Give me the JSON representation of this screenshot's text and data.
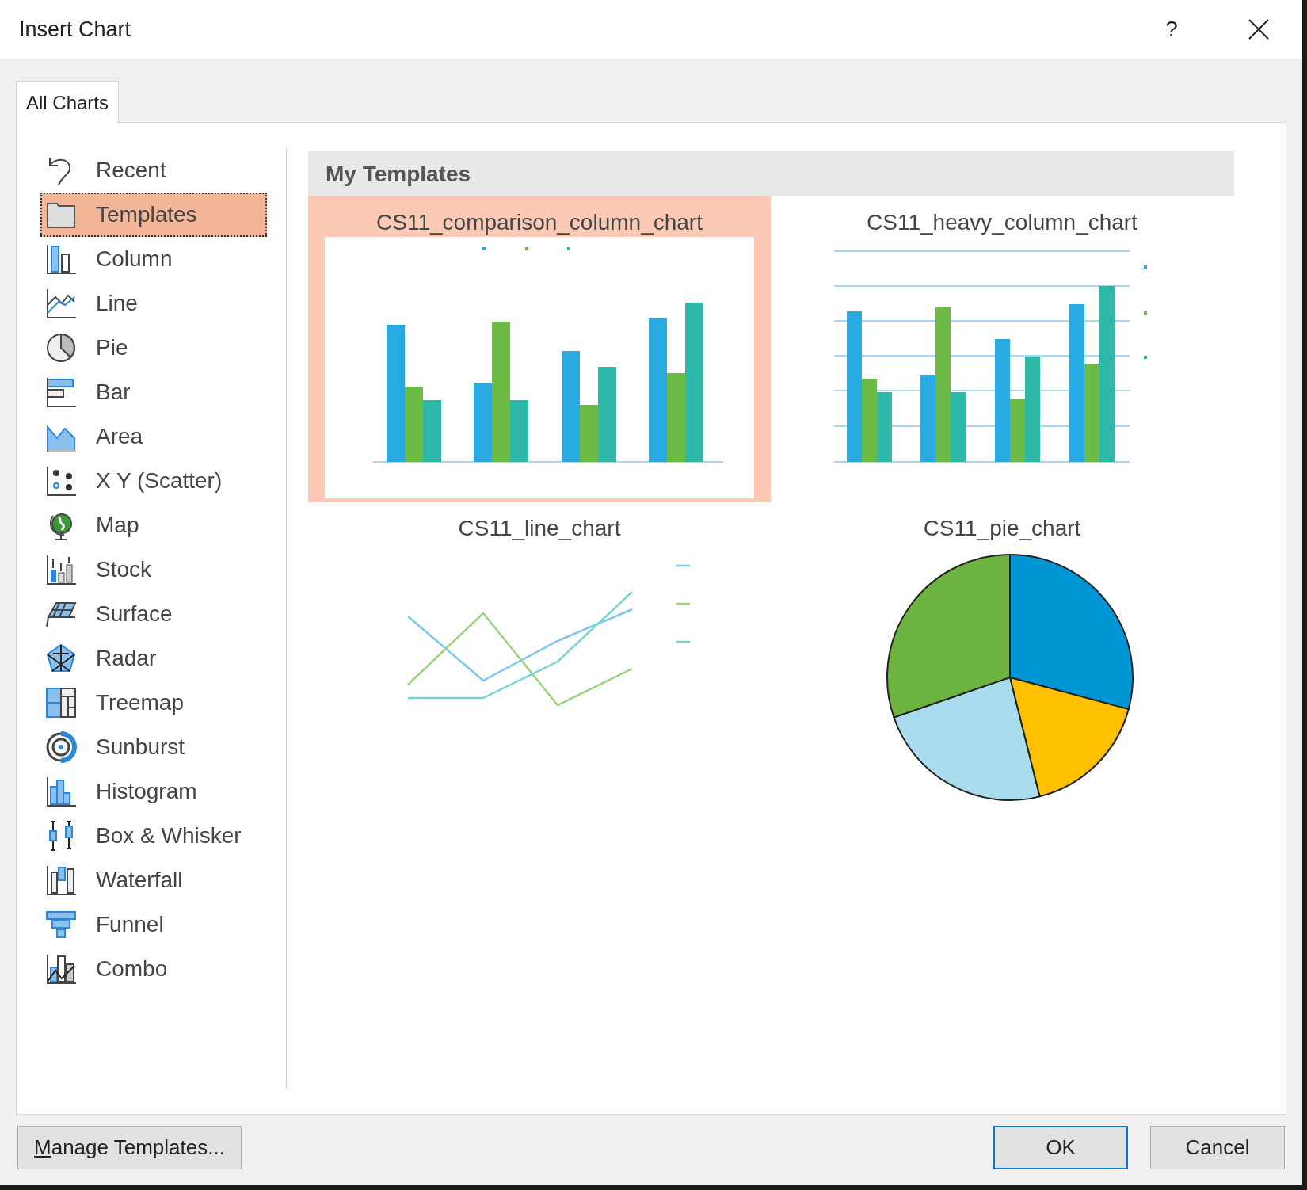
{
  "window": {
    "title": "Insert Chart",
    "help": "?"
  },
  "tabs": [
    {
      "label": "All Charts",
      "selected": true
    }
  ],
  "categories": [
    {
      "label": "Recent",
      "selected": false
    },
    {
      "label": "Templates",
      "selected": true
    },
    {
      "label": "Column",
      "selected": false
    },
    {
      "label": "Line",
      "selected": false
    },
    {
      "label": "Pie",
      "selected": false
    },
    {
      "label": "Bar",
      "selected": false
    },
    {
      "label": "Area",
      "selected": false
    },
    {
      "label": "X Y (Scatter)",
      "selected": false
    },
    {
      "label": "Map",
      "selected": false
    },
    {
      "label": "Stock",
      "selected": false
    },
    {
      "label": "Surface",
      "selected": false
    },
    {
      "label": "Radar",
      "selected": false
    },
    {
      "label": "Treemap",
      "selected": false
    },
    {
      "label": "Sunburst",
      "selected": false
    },
    {
      "label": "Histogram",
      "selected": false
    },
    {
      "label": "Box & Whisker",
      "selected": false
    },
    {
      "label": "Waterfall",
      "selected": false
    },
    {
      "label": "Funnel",
      "selected": false
    },
    {
      "label": "Combo",
      "selected": false
    }
  ],
  "templates": {
    "heading": "My Templates",
    "items": [
      {
        "name": "CS11_comparison_column_chart",
        "kind": "column",
        "selected": true
      },
      {
        "name": "CS11_heavy_column_chart",
        "kind": "gridcolumn",
        "selected": false
      },
      {
        "name": "CS11_line_chart",
        "kind": "line",
        "selected": false
      },
      {
        "name": "CS11_pie_chart",
        "kind": "pie",
        "selected": false
      }
    ]
  },
  "buttons": [
    {
      "label": "Manage Templates...",
      "access_key_underlined": true,
      "default": false
    },
    {
      "label": "OK",
      "default": true
    },
    {
      "label": "Cancel",
      "default": false
    }
  ]
}
